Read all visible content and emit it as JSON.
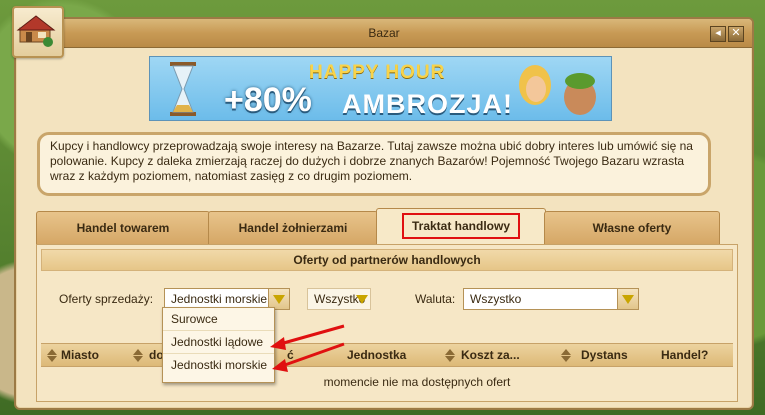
{
  "window": {
    "title": "Bazar",
    "buttons": {
      "back": "◂",
      "close": "✕"
    }
  },
  "banner": {
    "happy_hour": "HAPPY HOUR",
    "percent": "+80%",
    "product": "AMBROZJA!"
  },
  "description": "Kupcy i handlowcy przeprowadzają swoje interesy na Bazarze. Tutaj zawsze można ubić dobry interes lub umówić się na polowanie. Kupcy z daleka zmierzają raczej do dużych i dobrze znanych Bazarów! Pojemność Twojego Bazaru wzrasta wraz z każdym poziomem, natomiast zasięg z co drugim poziomem.",
  "tabs": [
    {
      "label": "Handel towarem"
    },
    {
      "label": "Handel żołnierzami"
    },
    {
      "label": "Traktat handlowy",
      "active": true
    },
    {
      "label": "Własne oferty"
    }
  ],
  "panel": {
    "heading": "Oferty od partnerów handlowych",
    "offers_label": "Oferty sprzedaży:",
    "offers_value": "Jednostki morskie",
    "second_value": "Wszystko",
    "currency_label": "Waluta:",
    "currency_value": "Wszystko",
    "dropdown_options": [
      "Surowce",
      "Jednostki lądowe",
      "Jednostki morskie"
    ],
    "columns": {
      "city": "Miasto",
      "col2": "do",
      "col3": "ć",
      "unit": "Jednostka",
      "cost": "Koszt za...",
      "distance": "Dystans",
      "trade": "Handel?"
    },
    "empty_text": "momencie nie ma dostępnych ofert"
  },
  "colors": {
    "accent_red": "#e01010",
    "highlight_yellow": "#c9a500"
  }
}
